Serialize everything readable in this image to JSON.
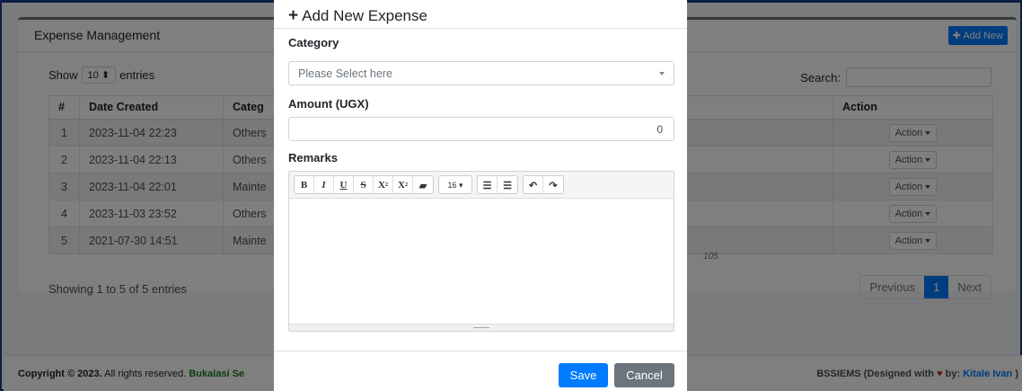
{
  "page": {
    "card_title": "Expense Management",
    "add_new_label": "Add New",
    "show_label": "Show",
    "entries_value": "10",
    "entries_label": "entries",
    "search_label": "Search:",
    "info_text": "Showing 1 to 5 of 5 entries",
    "pagination": {
      "previous": "Previous",
      "current": "1",
      "next": "Next"
    },
    "remark_fragment": "105"
  },
  "table": {
    "headers": {
      "num": "#",
      "date": "Date Created",
      "category": "Categ",
      "action": "Action"
    },
    "action_label": "Action",
    "rows": [
      {
        "num": "1",
        "date": "2023-11-04 22:23",
        "category": "Others"
      },
      {
        "num": "2",
        "date": "2023-11-04 22:13",
        "category": "Others"
      },
      {
        "num": "3",
        "date": "2023-11-04 22:01",
        "category": "Mainte"
      },
      {
        "num": "4",
        "date": "2023-11-03 23:52",
        "category": "Others"
      },
      {
        "num": "5",
        "date": "2021-07-30 14:51",
        "category": "Mainte"
      }
    ]
  },
  "footer": {
    "copyright": "Copyright © 2023.",
    "rights": " All rights reserved. ",
    "brand": "Bukalasi Se",
    "right_text": "BSSIEMS (Designed with ",
    "by": " by: ",
    "author": "Kitale Ivan",
    "right_end": " )"
  },
  "modal": {
    "title": "Add New Expense",
    "category_label": "Category",
    "category_placeholder": "Please Select here",
    "amount_label": "Amount (UGX)",
    "amount_value": "0",
    "remarks_label": "Remarks",
    "font_size": "16",
    "save_label": "Save",
    "cancel_label": "Cancel"
  },
  "colors": {
    "primary": "#007bff",
    "secondary": "#6c757d",
    "frame": "#1a3d8f",
    "brand_green": "#1b7a1b"
  }
}
